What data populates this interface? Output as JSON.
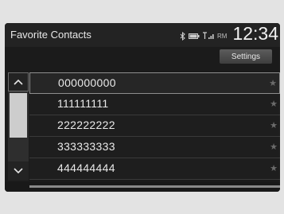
{
  "header": {
    "title": "Favorite Contacts",
    "status": {
      "indicator": "RM"
    },
    "clock": "12:34"
  },
  "toolbar": {
    "settings_label": "Settings"
  },
  "contacts": [
    {
      "number": "000000000",
      "star": "★"
    },
    {
      "number": "111111111",
      "star": "★"
    },
    {
      "number": "222222222",
      "star": "★"
    },
    {
      "number": "333333333",
      "star": "★"
    },
    {
      "number": "444444444",
      "star": "★"
    }
  ],
  "scroll": {
    "up_icon": "▲",
    "down_icon": "▼"
  }
}
